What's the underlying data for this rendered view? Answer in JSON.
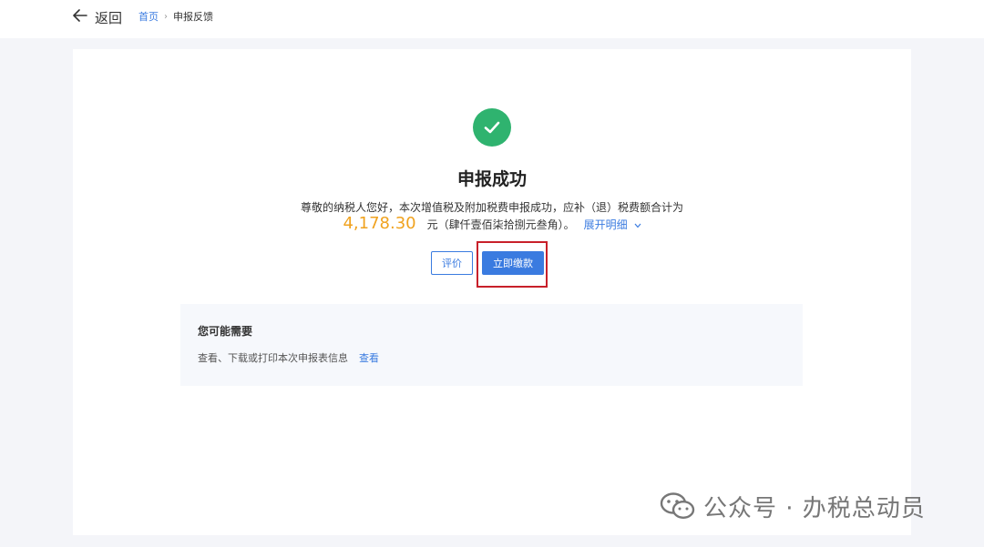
{
  "header": {
    "back_label": "返回",
    "breadcrumb_home": "首页",
    "breadcrumb_separator": "›",
    "breadcrumb_current": "申报反馈"
  },
  "result": {
    "title": "申报成功",
    "message": "尊敬的纳税人您好，本次增值税及附加税费申报成功，应补（退）税费额合计为",
    "amount": "4,178.30",
    "amount_words": "元（肆仟壹佰柒拾捌元叁角）。",
    "expand_label": "展开明细",
    "amount_color": "#f0a21e"
  },
  "actions": {
    "review_label": "评价",
    "pay_label": "立即缴款",
    "accent_color": "#3a7be0",
    "highlight_color": "#c8202a"
  },
  "maybe_need": {
    "title": "您可能需要",
    "item_text": "查看、下载或打印本次申报表信息",
    "item_link": "查看"
  },
  "watermark": {
    "text": "公众号 · 办税总动员",
    "icon": "wechat-icon"
  }
}
